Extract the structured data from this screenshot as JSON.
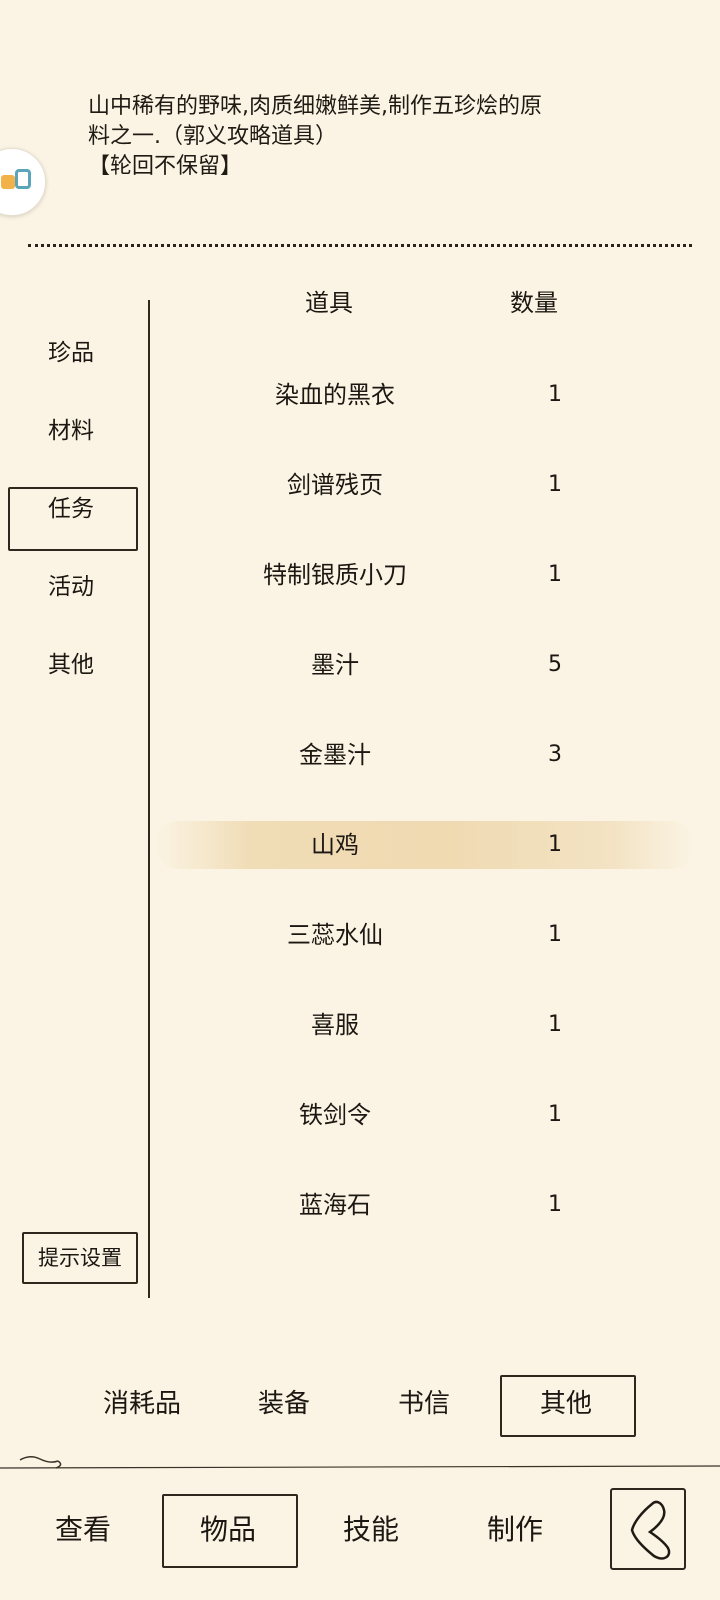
{
  "description": {
    "line1": "山中稀有的野味,肉质细嫩鲜美,制作五珍烩的原",
    "line2": "料之一.（郭义攻略道具）",
    "line3": "【轮回不保留】"
  },
  "table": {
    "col_item": "道具",
    "col_qty": "数量",
    "rows": [
      {
        "name": "染血的黑衣",
        "qty": "1"
      },
      {
        "name": "剑谱残页",
        "qty": "1"
      },
      {
        "name": "特制银质小刀",
        "qty": "1"
      },
      {
        "name": "墨汁",
        "qty": "5"
      },
      {
        "name": "金墨汁",
        "qty": "3"
      },
      {
        "name": "山鸡",
        "qty": "1"
      },
      {
        "name": "三蕊水仙",
        "qty": "1"
      },
      {
        "name": "喜服",
        "qty": "1"
      },
      {
        "name": "铁剑令",
        "qty": "1"
      },
      {
        "name": "蓝海石",
        "qty": "1"
      }
    ],
    "selected_row": "山鸡"
  },
  "categories": [
    {
      "label": "珍品"
    },
    {
      "label": "材料"
    },
    {
      "label": "任务"
    },
    {
      "label": "活动"
    },
    {
      "label": "其他"
    }
  ],
  "selected_category": "任务",
  "hint_button": "提示设置",
  "sub_tabs": [
    {
      "label": "消耗品"
    },
    {
      "label": "装备"
    },
    {
      "label": "书信"
    },
    {
      "label": "其他"
    }
  ],
  "selected_sub_tab": "其他",
  "bottom_nav": [
    {
      "label": "查看"
    },
    {
      "label": "物品"
    },
    {
      "label": "技能"
    },
    {
      "label": "制作"
    }
  ],
  "selected_bottom_nav": "物品",
  "back_icon": "back-chevron-icon",
  "floating_icon": "app-floating-icon"
}
